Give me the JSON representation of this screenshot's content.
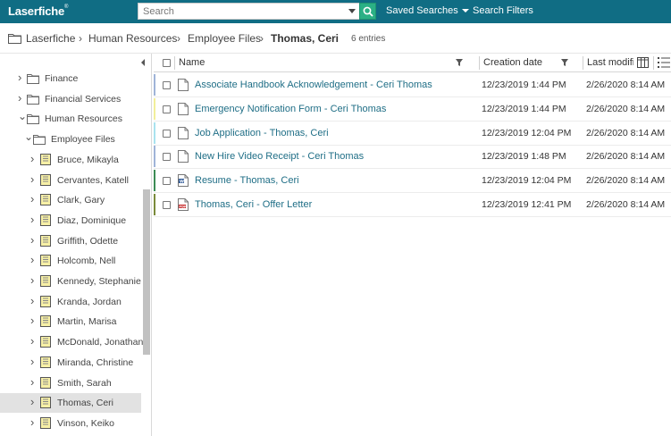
{
  "topbar": {
    "logo": "Laserfiche",
    "search_placeholder": "Search",
    "saved_searches": "Saved Searches",
    "search_filters": "Search Filters",
    "accent": "#106d84"
  },
  "breadcrumb": {
    "items": [
      "Laserfiche",
      "Human Resources",
      "Employee Files",
      "Thomas, Ceri"
    ],
    "separator": "›",
    "entries": "6 entries"
  },
  "tree": {
    "items": [
      {
        "label": "Finance",
        "icon": "folder-icon"
      },
      {
        "label": "Financial Services",
        "icon": "folder-icon"
      },
      {
        "label": "Human Resources",
        "icon": "folder-icon"
      },
      {
        "label": "Employee Files",
        "icon": "folder-icon"
      },
      {
        "label": "Bruce, Mikayla",
        "icon": "record-folder-icon"
      },
      {
        "label": "Cervantes, Katell",
        "icon": "record-folder-icon"
      },
      {
        "label": "Clark, Gary",
        "icon": "record-folder-icon"
      },
      {
        "label": "Diaz, Dominique",
        "icon": "record-folder-icon"
      },
      {
        "label": "Griffith, Odette",
        "icon": "record-folder-icon"
      },
      {
        "label": "Holcomb, Nell",
        "icon": "record-folder-icon"
      },
      {
        "label": "Kennedy, Stephanie",
        "icon": "record-folder-icon"
      },
      {
        "label": "Kranda, Jordan",
        "icon": "record-folder-icon"
      },
      {
        "label": "Martin, Marisa",
        "icon": "record-folder-icon"
      },
      {
        "label": "McDonald, Jonathan",
        "icon": "record-folder-icon"
      },
      {
        "label": "Miranda, Christine",
        "icon": "record-folder-icon"
      },
      {
        "label": "Smith, Sarah",
        "icon": "record-folder-icon"
      },
      {
        "label": "Thomas, Ceri",
        "icon": "record-folder-icon"
      },
      {
        "label": "Vinson, Keiko",
        "icon": "record-folder-icon"
      }
    ],
    "selected": "Thomas, Ceri"
  },
  "grid": {
    "columns": [
      "Name",
      "Creation date",
      "Last modifi"
    ],
    "rows": [
      {
        "name": "Associate Handbook Acknowledgement - Ceri Thomas",
        "created": "12/23/2019 1:44 PM",
        "modified": "2/26/2020 8:14 AM",
        "icon": "document-icon",
        "stripe": "#9fb4d8"
      },
      {
        "name": "Emergency Notification Form - Ceri Thomas",
        "created": "12/23/2019 1:44 PM",
        "modified": "2/26/2020 8:14 AM",
        "icon": "document-icon",
        "stripe": "#f2ef9a"
      },
      {
        "name": "Job Application - Thomas, Ceri",
        "created": "12/23/2019 12:04 PM",
        "modified": "2/26/2020 8:14 AM",
        "icon": "document-icon",
        "stripe": "#a9e3ef"
      },
      {
        "name": "New Hire Video Receipt - Ceri Thomas",
        "created": "12/23/2019 1:48 PM",
        "modified": "2/26/2020 8:14 AM",
        "icon": "document-icon",
        "stripe": "#9fb4d8"
      },
      {
        "name": "Resume - Thomas, Ceri",
        "created": "12/23/2019 12:04 PM",
        "modified": "2/26/2020 8:14 AM",
        "icon": "word-document-icon",
        "stripe": "#3c8c55"
      },
      {
        "name": "Thomas, Ceri - Offer Letter",
        "created": "12/23/2019 12:41 PM",
        "modified": "2/26/2020 8:14 AM",
        "icon": "pdf-document-icon",
        "stripe": "#7a8a3a"
      }
    ]
  }
}
